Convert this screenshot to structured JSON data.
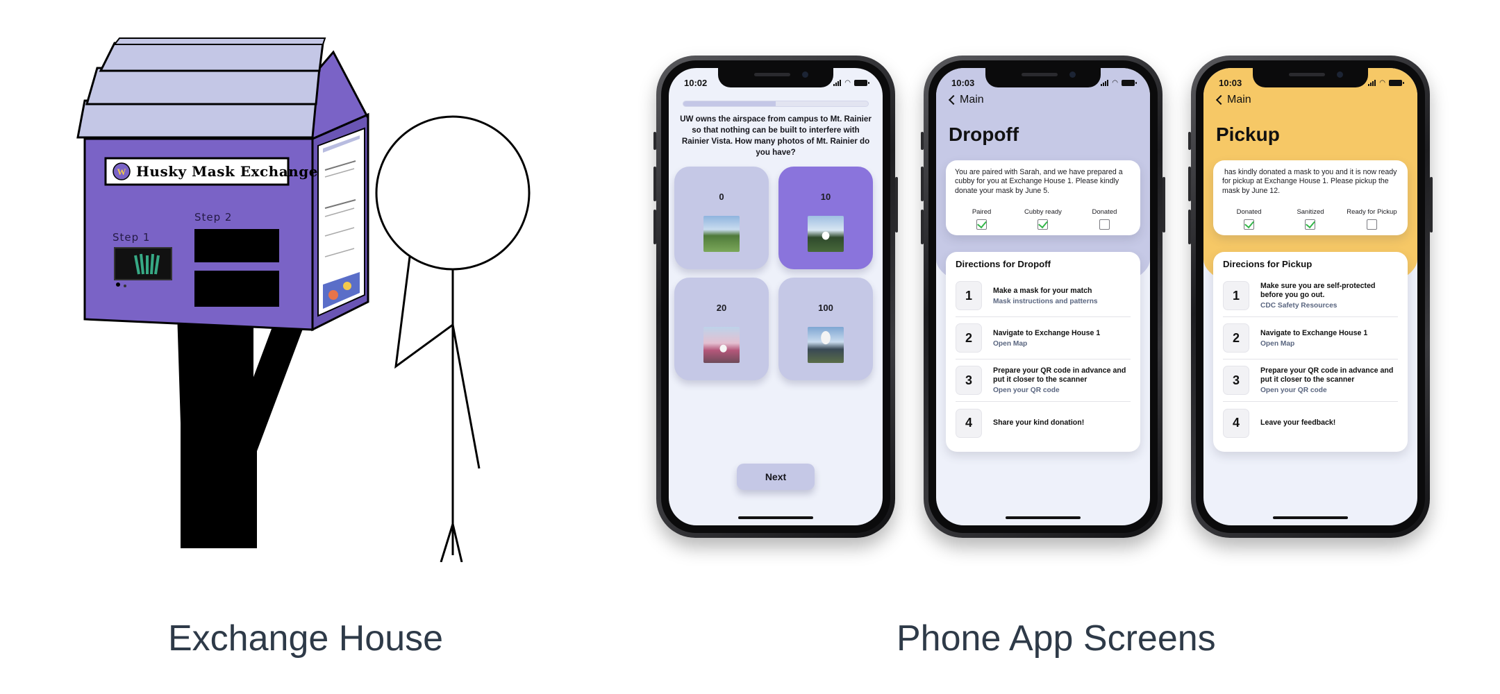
{
  "captions": {
    "left": "Exchange House",
    "right": "Phone App Screens"
  },
  "house": {
    "sign": "Husky Mask Exchange",
    "logo_letter": "W",
    "step1": "Step 1",
    "step2": "Step 2",
    "colors": {
      "body": "#7a63c6",
      "roof": "#c4c7e6",
      "post": "#000000"
    }
  },
  "quiz_screen": {
    "time": "10:02",
    "progress": 0.5,
    "question": "UW owns the airspace from campus to Mt. Rainier so that nothing can be built to interfere with Rainier Vista. How many photos of Mt. Rainier do you have?",
    "options": [
      {
        "label": "0",
        "selected": false
      },
      {
        "label": "10",
        "selected": true
      },
      {
        "label": "20",
        "selected": false
      },
      {
        "label": "100",
        "selected": false
      }
    ],
    "next": "Next",
    "colors": {
      "option": "#c5c8e6",
      "selected": "#8a74dc"
    }
  },
  "dropoff_screen": {
    "time": "10:03",
    "back": "Main",
    "title": "Dropoff",
    "message": "You are paired with Sarah, and we have prepared a cubby for you at Exchange House 1. Please kindly donate your mask by June 5.",
    "statuses": [
      {
        "label": "Paired",
        "checked": true
      },
      {
        "label": "Cubby ready",
        "checked": true
      },
      {
        "label": "Donated",
        "checked": false
      }
    ],
    "directions_title": "Directions for Dropoff",
    "steps": [
      {
        "num": "1",
        "text": "Make a mask for your match",
        "link": "Mask instructions and patterns"
      },
      {
        "num": "2",
        "text": "Navigate to Exchange House 1",
        "link": "Open Map"
      },
      {
        "num": "3",
        "text": "Prepare your QR code in advance and put it closer to the scanner",
        "link": "Open your QR code"
      },
      {
        "num": "4",
        "text": "Share your kind donation!",
        "link": ""
      }
    ],
    "accent": "#c6c9e6"
  },
  "pickup_screen": {
    "time": "10:03",
    "back": "Main",
    "title": "Pickup",
    "message": " has kindly donated a mask to you and it is now ready for pickup at Exchange House 1. Please pickup the mask by June 12.",
    "statuses": [
      {
        "label": "Donated",
        "checked": true
      },
      {
        "label": "Sanitized",
        "checked": true
      },
      {
        "label": "Ready for Pickup",
        "checked": false
      }
    ],
    "directions_title": "Direcions for Pickup",
    "steps": [
      {
        "num": "1",
        "text": "Make sure you are self-protected before you go out.",
        "link": "CDC Safety Resources"
      },
      {
        "num": "2",
        "text": "Navigate to Exchange House 1",
        "link": "Open Map"
      },
      {
        "num": "3",
        "text": "Prepare your QR code in advance and put it closer to the scanner",
        "link": "Open your QR code"
      },
      {
        "num": "4",
        "text": "Leave your feedback!",
        "link": ""
      }
    ],
    "accent": "#f6c866"
  }
}
